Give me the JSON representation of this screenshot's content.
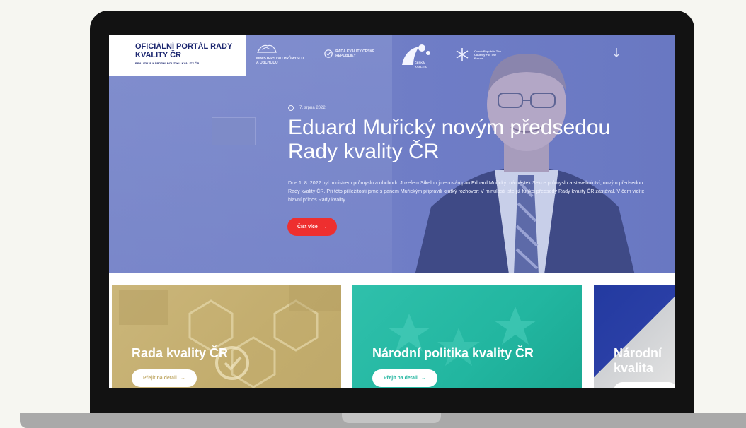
{
  "header": {
    "logo_title": "OFICIÁLNÍ PORTÁL RADY KVALITY ČR",
    "logo_subtitle": "REALIZUJE NÁRODNÍ POLITIKU KVALITY ČR",
    "partners": [
      {
        "name": "MINISTERSTVO PRŮMYSLU A OBCHODU"
      },
      {
        "name": "RADA KVALITY ČESKÉ REPUBLIKY"
      },
      {
        "name": "ČESKÁ KVALITA"
      },
      {
        "name": "Czech Republic The Country For The Future"
      }
    ]
  },
  "hero": {
    "date": "7. srpna 2022",
    "title": "Eduard Muřický novým předsedou Rady kvality ČR",
    "text": "Dne 1. 8. 2022 byl ministrem průmyslu a obchodu Jozefem Síkelou jmenován pan Eduard Muřický, náměstek Sekce průmyslu a stavebnictví, novým předsedou Rady kvality ČR. Při této příležitosti jsme s panem Muřickým připravili krátký rozhovor: V minulosti jste již funkci předsedy Rady kvality ČR zastával. V čem vidíte hlavní přínos Rady kvality...",
    "button_label": "Číst více",
    "button_arrow": "→"
  },
  "cards": [
    {
      "title": "Rada kvality ČR",
      "button_label": "Přejít na detail",
      "arrow": "→",
      "accent": "#c3ad6e"
    },
    {
      "title": "Národní politika kvality ČR",
      "button_label": "Přejít na detail",
      "arrow": "→",
      "accent": "#22b6a0"
    },
    {
      "title": "Národní kvalita",
      "accent": "#2a3fa6"
    }
  ],
  "colors": {
    "hero_overlay": "#6f7dc6",
    "brand_navy": "#1c2770",
    "button_red": "#ee2f2f",
    "laptop_frame": "#121212"
  }
}
